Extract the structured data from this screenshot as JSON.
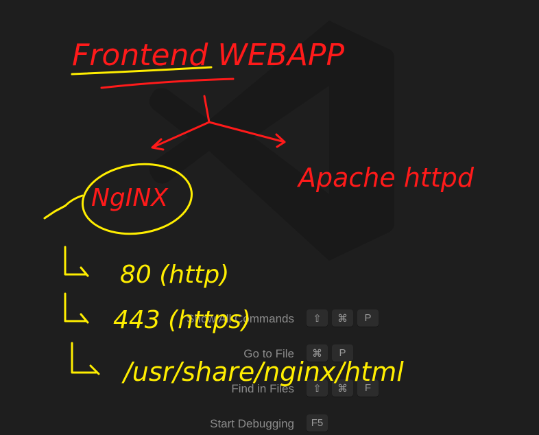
{
  "commands": [
    {
      "label": "Show All Commands",
      "keys": [
        "⇧",
        "⌘",
        "P"
      ]
    },
    {
      "label": "Go to File",
      "keys": [
        "⌘",
        "P"
      ]
    },
    {
      "label": "Find in Files",
      "keys": [
        "⇧",
        "⌘",
        "F"
      ]
    },
    {
      "label": "Start Debugging",
      "keys": [
        "F5"
      ]
    }
  ],
  "annotations": {
    "title": "Frontend WEBAPP",
    "nginx": "NgINX",
    "apache": "Apache httpd",
    "port80": "80 (http)",
    "port443": "443 (https)",
    "path": "/usr/share/nginx/html"
  },
  "colors": {
    "background": "#1e1e1e",
    "red_ink": "#ff1a1a",
    "yellow_ink": "#ffee00"
  }
}
